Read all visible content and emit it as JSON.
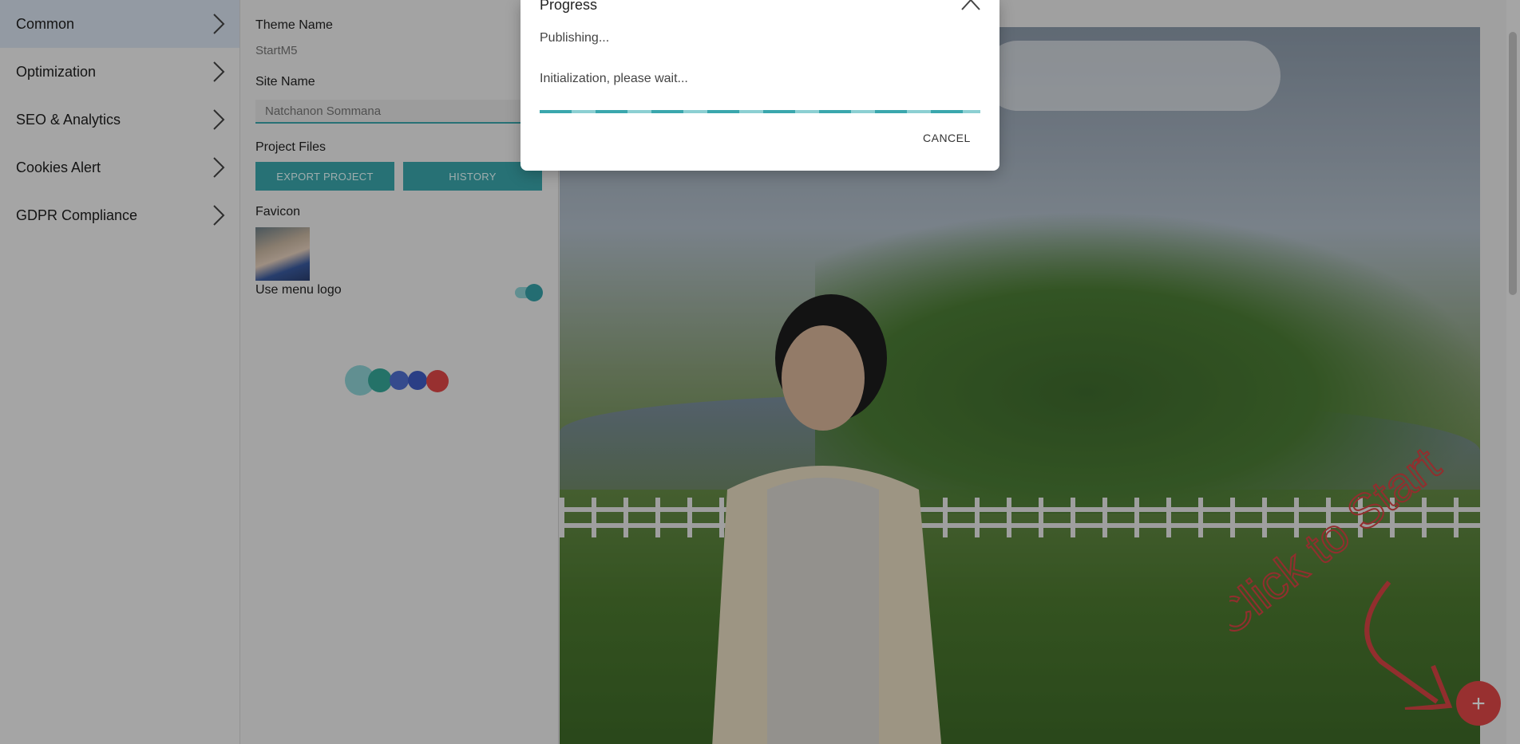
{
  "sidebar": {
    "items": [
      {
        "label": "Common",
        "icon": "chevron-right-icon"
      },
      {
        "label": "Optimization",
        "icon": "chevron-right-icon"
      },
      {
        "label": "SEO & Analytics",
        "icon": "chevron-right-icon"
      },
      {
        "label": "Cookies Alert",
        "icon": "chevron-right-icon"
      },
      {
        "label": "GDPR Compliance",
        "icon": "chevron-right-icon"
      }
    ]
  },
  "settings": {
    "theme_name_label": "Theme Name",
    "theme_name_value": "StartM5",
    "site_name_label": "Site Name",
    "site_name_value": "Natchanon Sommana",
    "project_files_label": "Project Files",
    "export_label": "EXPORT PROJECT",
    "history_label": "HISTORY",
    "favicon_label": "Favicon",
    "use_menu_logo_label": "Use menu logo",
    "use_menu_logo_on": true,
    "accent_color": "#3aa7ad"
  },
  "preview": {
    "hint_text": "Click to Start",
    "fab_label": "+",
    "fab_color": "#e04848"
  },
  "dialog": {
    "title": "Progress",
    "line1": "Publishing...",
    "line2": "Initialization, please wait...",
    "cancel_label": "CANCEL"
  }
}
